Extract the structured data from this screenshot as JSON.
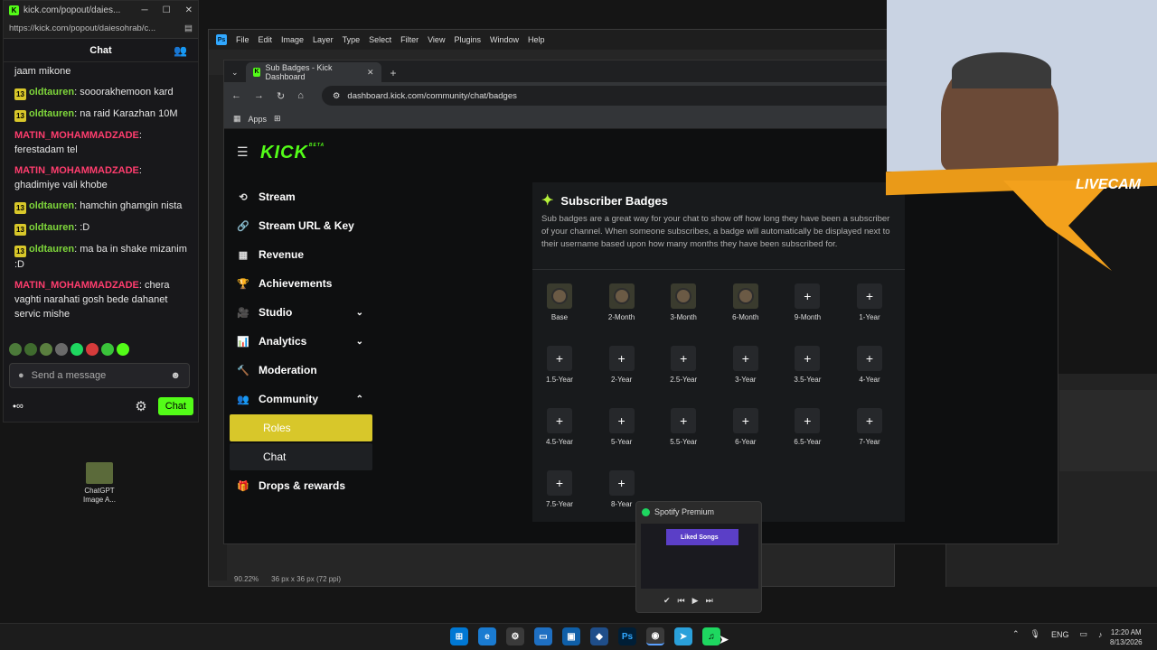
{
  "chat_window": {
    "url": "https://kick.com/popout/daiesohrab/c...",
    "title_url": "kick.com/popout/daies...",
    "header": "Chat",
    "messages": [
      {
        "badge": "",
        "user": "",
        "text": "jaam mikone"
      },
      {
        "badge": "13",
        "user": "oldtauren",
        "color": "green",
        "text": "sooorakhemoon kard"
      },
      {
        "badge": "13",
        "user": "oldtauren",
        "color": "green",
        "text": "na raid Karazhan 10M"
      },
      {
        "badge": "",
        "user": "MATIN_MOHAMMADZADE",
        "color": "red",
        "text": "ferestadam tel"
      },
      {
        "badge": "",
        "user": "MATIN_MOHAMMADZADE",
        "color": "red",
        "text": "ghadimiye vali khobe"
      },
      {
        "badge": "13",
        "user": "oldtauren",
        "color": "green",
        "text": "hamchin ghamgin nista"
      },
      {
        "badge": "13",
        "user": "oldtauren",
        "color": "green",
        "text": ":D"
      },
      {
        "badge": "13",
        "user": "oldtauren",
        "color": "green",
        "text": "ma ba in shake mizanim :D"
      },
      {
        "badge": "",
        "user": "MATIN_MOHAMMADZADE",
        "color": "red",
        "text": "chera vaghti narahati gosh bede dahanet servic mishe"
      }
    ],
    "input_placeholder": "Send a message",
    "chat_button": "Chat"
  },
  "desktop_icon": {
    "label": "ChatGPT Image A..."
  },
  "photoshop": {
    "menu": [
      "File",
      "Edit",
      "Image",
      "Layer",
      "Type",
      "Select",
      "Filter",
      "View",
      "Plugins",
      "Window",
      "Help"
    ],
    "zoom": "90.22%",
    "doc_info": "36 px x 36 px (72 ppi)"
  },
  "browser": {
    "tab_title": "Sub Badges - Kick Dashboard",
    "url": "dashboard.kick.com/community/chat/badges",
    "bookmark": "Apps"
  },
  "dashboard": {
    "logo": "KICK",
    "logo_tag": "BETA",
    "nav": [
      {
        "label": "Stream",
        "icon": "⟲"
      },
      {
        "label": "Stream URL & Key",
        "icon": "🔗"
      },
      {
        "label": "Revenue",
        "icon": "▦"
      },
      {
        "label": "Achievements",
        "icon": "🏆"
      },
      {
        "label": "Studio",
        "icon": "🎥"
      },
      {
        "label": "Analytics",
        "icon": "📊"
      },
      {
        "label": "Moderation",
        "icon": "🔨"
      },
      {
        "label": "Community",
        "icon": "👥"
      },
      {
        "label": "Roles",
        "icon": ""
      },
      {
        "label": "Chat",
        "icon": ""
      },
      {
        "label": "Drops & rewards",
        "icon": "🎁"
      }
    ],
    "panel": {
      "title": "Subscriber Badges",
      "description": "Sub badges are a great way for your chat to show off how long they have been a subscriber of your channel. When someone subscribes, a badge will automatically be displayed next to their username based upon how many months they have been subscribed for.",
      "badges": [
        "Base",
        "2-Month",
        "3-Month",
        "6-Month",
        "9-Month",
        "1-Year",
        "1.5-Year",
        "2-Year",
        "2.5-Year",
        "3-Year",
        "3.5-Year",
        "4-Year",
        "4.5-Year",
        "5-Year",
        "5.5-Year",
        "6-Year",
        "6.5-Year",
        "7-Year",
        "7.5-Year",
        "8-Year"
      ],
      "badges_with_image": 4
    }
  },
  "spotify": {
    "title": "Spotify Premium",
    "playlist": "Liked Songs"
  },
  "webcam": {
    "overlay_text": "LIVECAM"
  },
  "taskbar": {
    "language": "ENG",
    "time": "12:20 AM",
    "date": "8/13/2026"
  }
}
